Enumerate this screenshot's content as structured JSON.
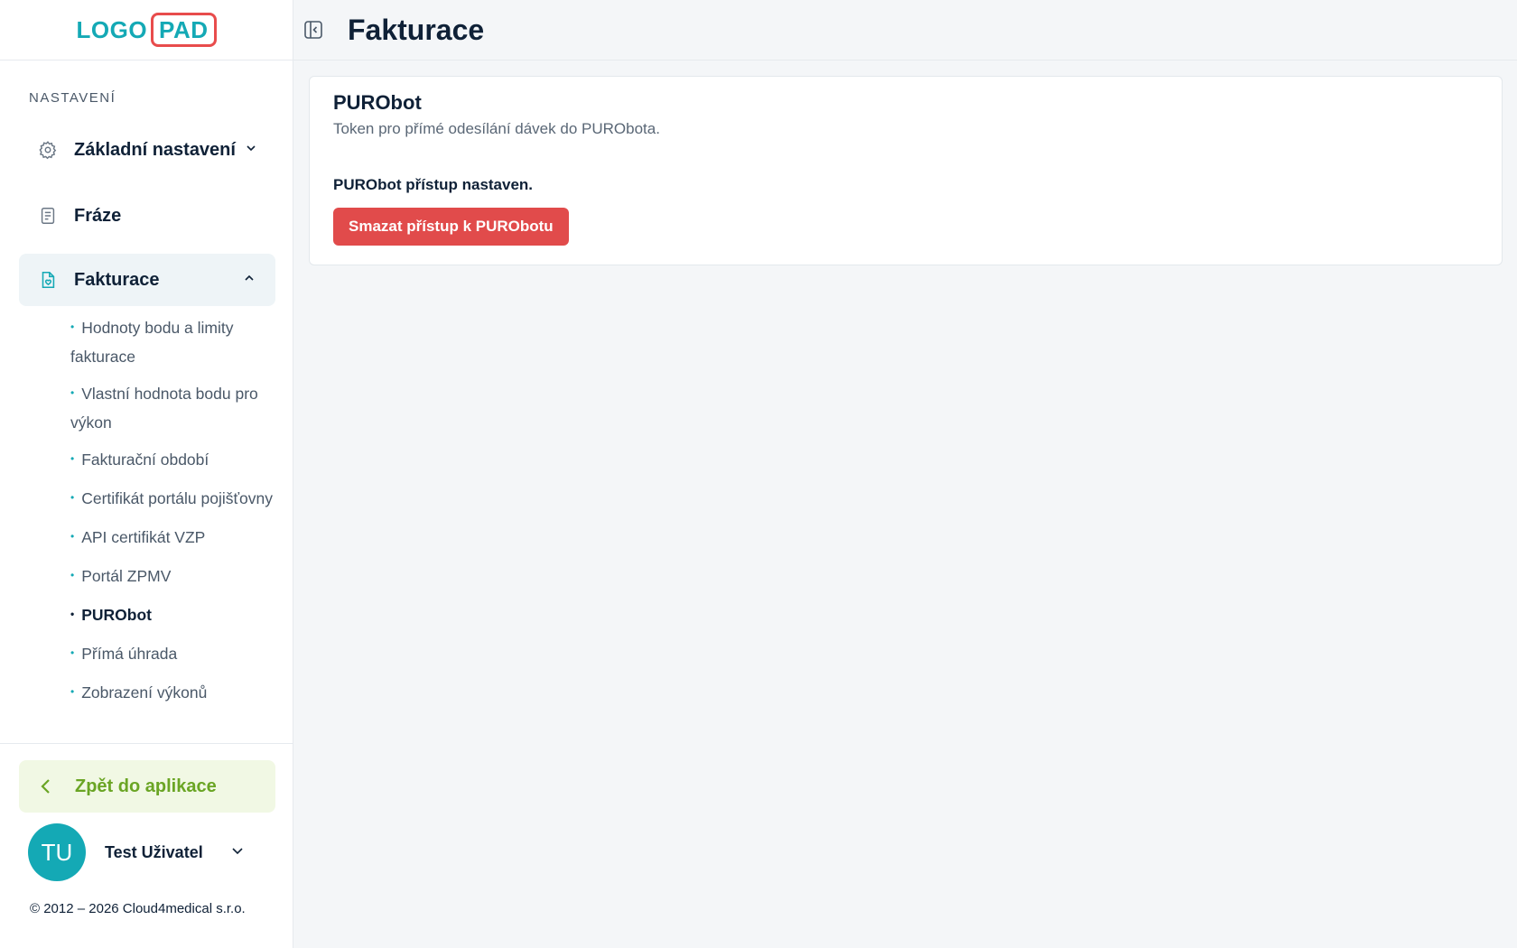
{
  "logo": {
    "part1": "LOGO",
    "part2": "PAD"
  },
  "sidebar": {
    "section_label": "NASTAVENÍ",
    "items": [
      {
        "label": "Základní nastavení",
        "icon": "gear-icon"
      },
      {
        "label": "Fráze",
        "icon": "document-icon"
      },
      {
        "label": "Fakturace",
        "icon": "invoice-icon"
      }
    ],
    "sub_items": [
      {
        "label": "Hodnoty bodu a limity fakturace"
      },
      {
        "label": "Vlastní hodnota bodu pro výkon"
      },
      {
        "label": "Fakturační období"
      },
      {
        "label": "Certifikát portálu pojišťovny"
      },
      {
        "label": "API certifikát VZP"
      },
      {
        "label": "Portál ZPMV"
      },
      {
        "label": "PURObot"
      },
      {
        "label": "Přímá úhrada"
      },
      {
        "label": "Zobrazení výkonů"
      }
    ],
    "back_label": "Zpět do aplikace",
    "user": {
      "initials": "TU",
      "name": "Test Uživatel"
    },
    "copyright": "© 2012 – 2026 Cloud4medical s.r.o."
  },
  "header": {
    "title": "Fakturace"
  },
  "card": {
    "title": "PURObot",
    "subtitle": "Token pro přímé odesílání dávek do PURObota.",
    "status": "PURObot přístup nastaven.",
    "delete_button": "Smazat přístup k PURObotu"
  },
  "colors": {
    "accent": "#14a9b5",
    "danger": "#e14b4b",
    "back": "#6aa524",
    "logo_border": "#e84c4c"
  }
}
